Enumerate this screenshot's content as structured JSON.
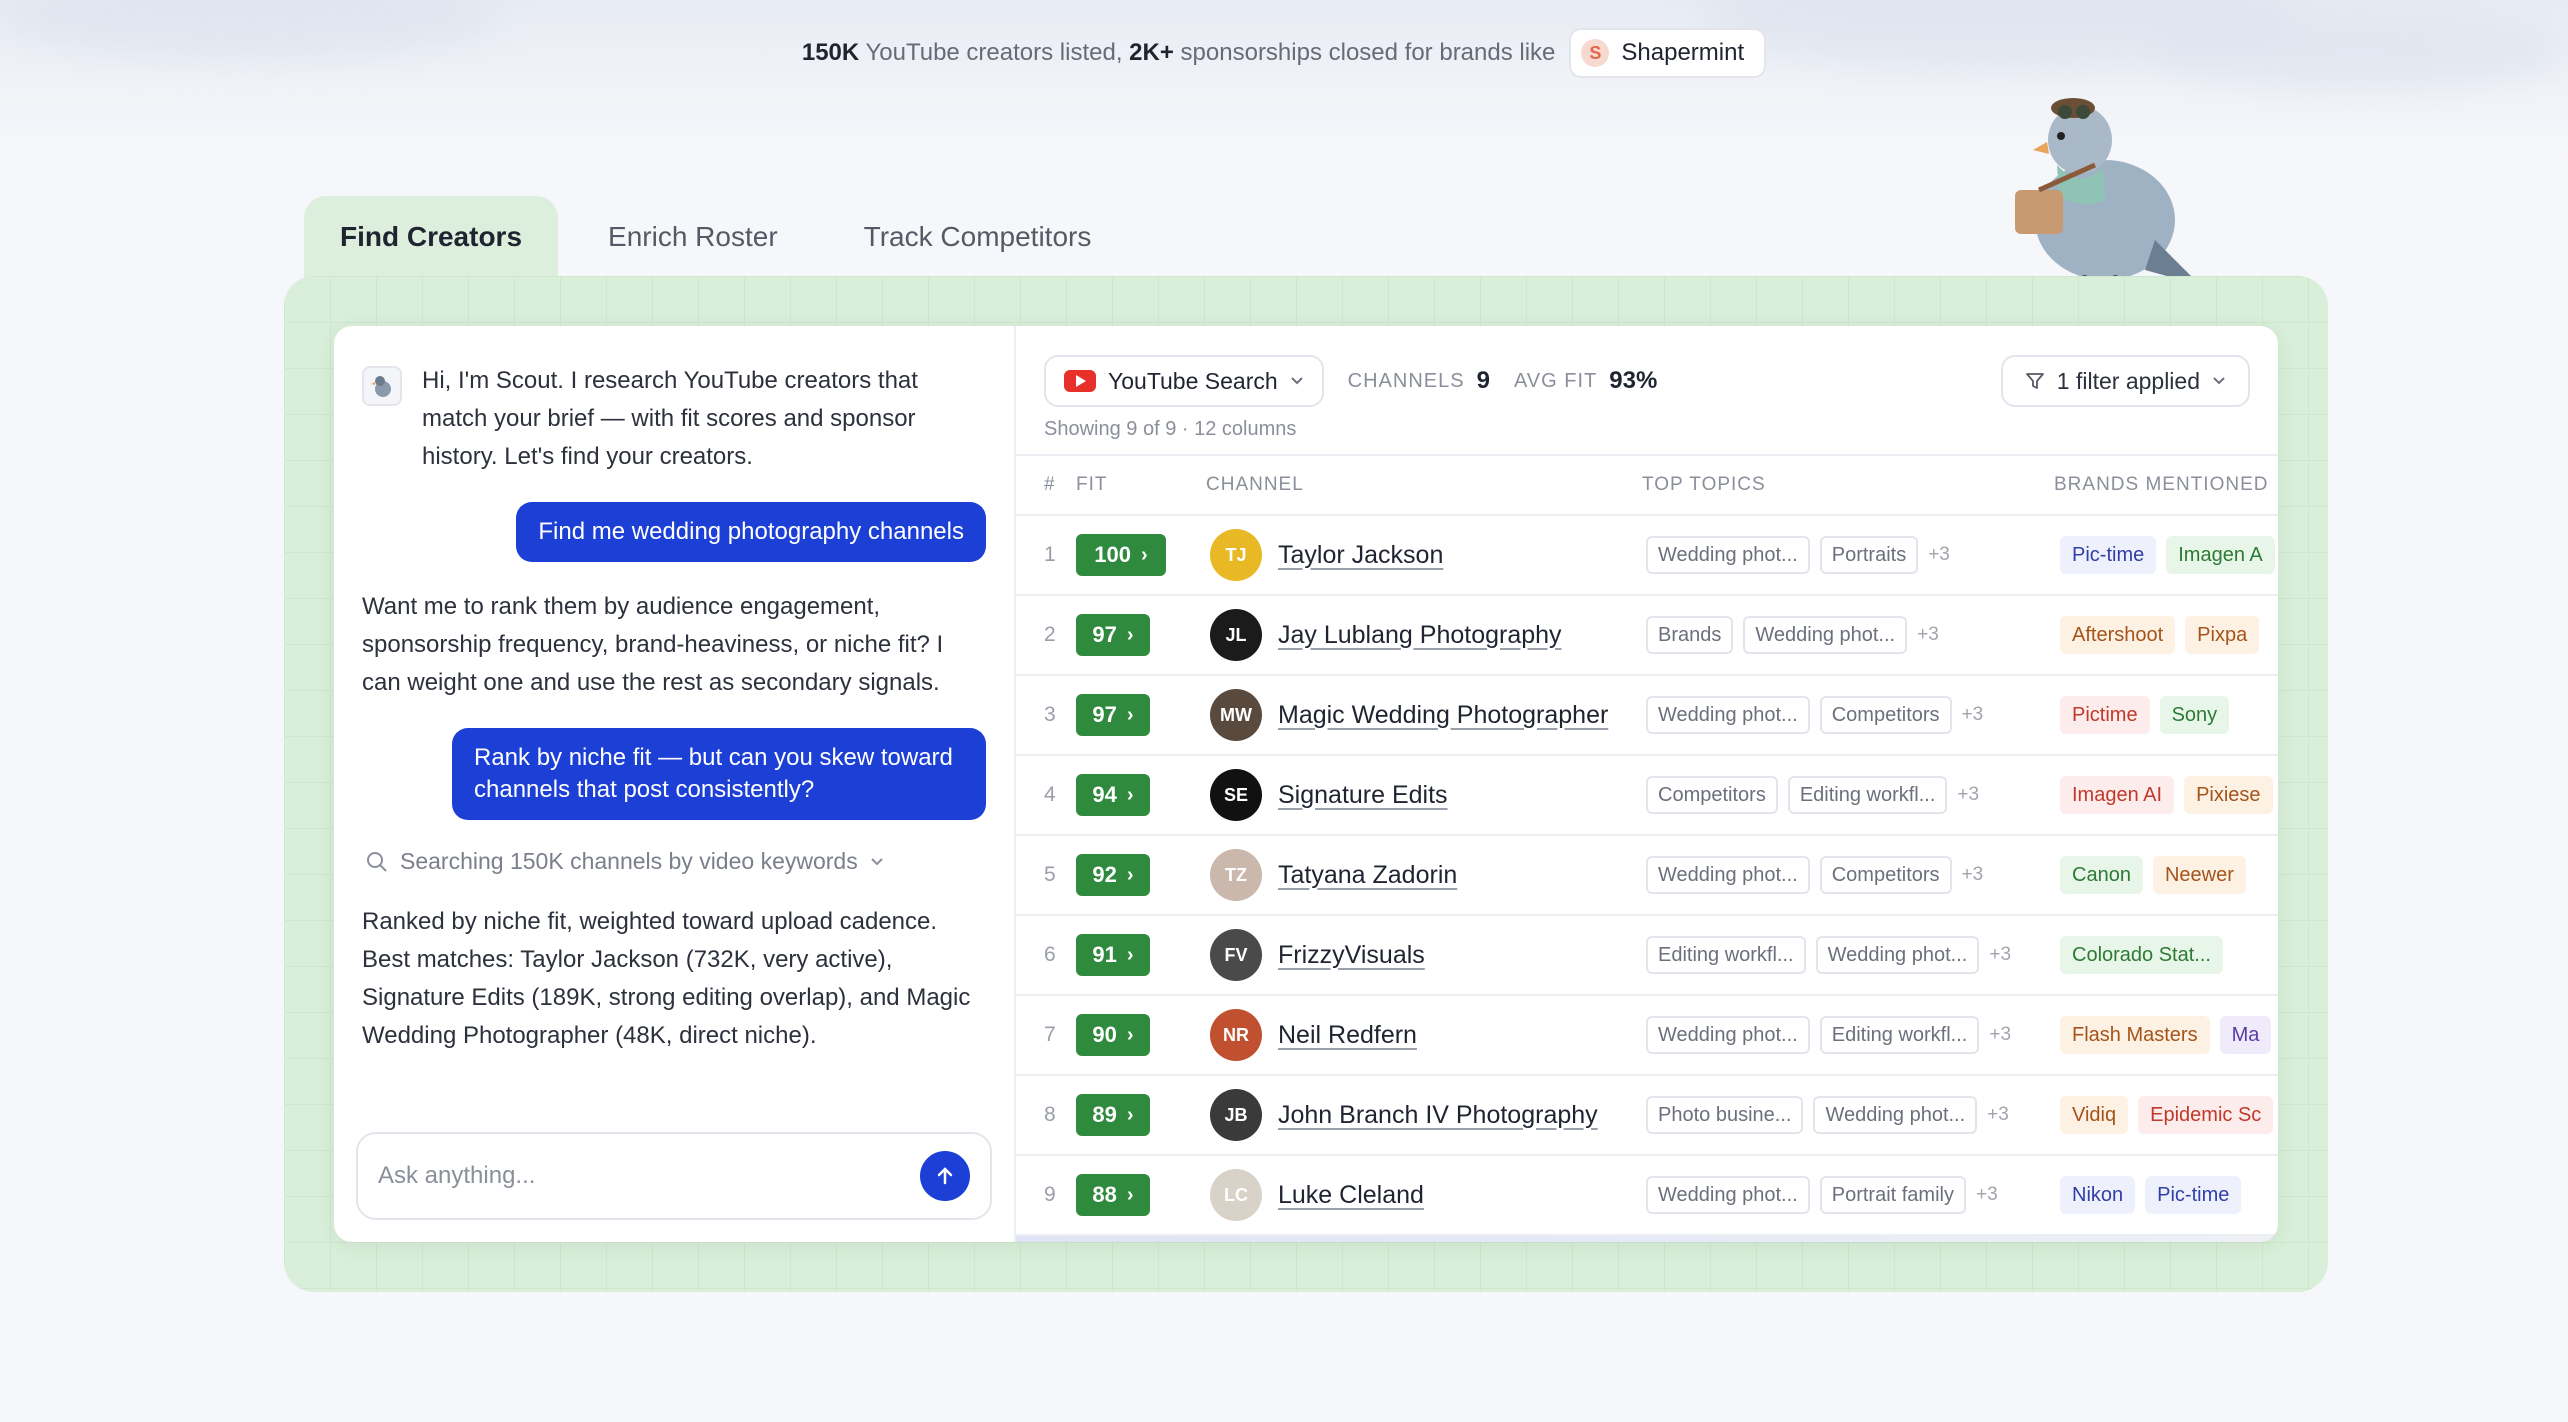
{
  "banner": {
    "count_creators": "150K",
    "text_creators": "YouTube creators listed,",
    "count_sponsorships": "2K+",
    "text_sponsorships": "sponsorships closed for brands like",
    "brand_name": "Shapermint",
    "brand_logo_letter": "S"
  },
  "tabs": [
    {
      "label": "Find Creators",
      "active": true
    },
    {
      "label": "Enrich Roster",
      "active": false
    },
    {
      "label": "Track Competitors",
      "active": false
    }
  ],
  "chat": {
    "greeting": "Hi, I'm Scout. I research YouTube creators that match your brief — with fit scores and sponsor history. Let's find your creators.",
    "user_1": "Find me wedding photography channels",
    "assistant_1": "Want me to rank them by audience engagement, sponsorship frequency, brand-heaviness, or niche fit? I can weight one and use the rest as secondary signals.",
    "user_2": "Rank by niche fit — but can you skew toward channels that post consistently?",
    "searching": "Searching 150K channels by video keywords",
    "assistant_2": "Ranked by niche fit, weighted toward upload cadence. Best matches: Taylor Jackson (732K, very active), Signature Edits (189K, strong editing overlap), and Magic Wedding Photographer (48K, direct niche).",
    "input_placeholder": "Ask anything..."
  },
  "toolbar": {
    "source": "YouTube Search",
    "channels_label": "CHANNELS",
    "channels_value": "9",
    "avgfit_label": "AVG FIT",
    "avgfit_value": "93%",
    "filter": "1 filter applied",
    "showing": "Showing 9 of 9 · 12 columns"
  },
  "table": {
    "headers": [
      "#",
      "FIT",
      "CHANNEL",
      "TOP TOPICS",
      "BRANDS MENTIONED"
    ],
    "rows": [
      {
        "rank": "1",
        "fit": "100",
        "channel": "Taylor Jackson",
        "avatar": "TJ",
        "avatar_color": "#e8b825",
        "topics": [
          "Wedding phot...",
          "Portraits"
        ],
        "more": "+3",
        "brands": [
          {
            "name": "Pic-time",
            "tone": "blue"
          },
          {
            "name": "Imagen A",
            "tone": "green"
          }
        ]
      },
      {
        "rank": "2",
        "fit": "97",
        "channel": "Jay Lublang Photography",
        "avatar": "JL",
        "avatar_color": "#1b1b1b",
        "topics": [
          "Brands",
          "Wedding phot..."
        ],
        "more": "+3",
        "brands": [
          {
            "name": "Aftershoot",
            "tone": "orange"
          },
          {
            "name": "Pixpa",
            "tone": "orange"
          }
        ]
      },
      {
        "rank": "3",
        "fit": "97",
        "channel": "Magic Wedding Photographer",
        "avatar": "MW",
        "avatar_color": "#5a4a3e",
        "topics": [
          "Wedding phot...",
          "Competitors"
        ],
        "more": "+3",
        "brands": [
          {
            "name": "Pictime",
            "tone": "red"
          },
          {
            "name": "Sony",
            "tone": "green"
          }
        ]
      },
      {
        "rank": "4",
        "fit": "94",
        "channel": "Signature Edits",
        "avatar": "SE",
        "avatar_color": "#111111",
        "topics": [
          "Competitors",
          "Editing workfl..."
        ],
        "more": "+3",
        "brands": [
          {
            "name": "Imagen AI",
            "tone": "red"
          },
          {
            "name": "Pixiese",
            "tone": "orange"
          }
        ]
      },
      {
        "rank": "5",
        "fit": "92",
        "channel": "Tatyana Zadorin",
        "avatar": "TZ",
        "avatar_color": "#c9b8ab",
        "topics": [
          "Wedding phot...",
          "Competitors"
        ],
        "more": "+3",
        "brands": [
          {
            "name": "Canon",
            "tone": "green"
          },
          {
            "name": "Neewer",
            "tone": "orange"
          }
        ]
      },
      {
        "rank": "6",
        "fit": "91",
        "channel": "FrizzyVisuals",
        "avatar": "FV",
        "avatar_color": "#4a4a4a",
        "topics": [
          "Editing workfl...",
          "Wedding phot..."
        ],
        "more": "+3",
        "brands": [
          {
            "name": "Colorado Stat...",
            "tone": "green"
          }
        ]
      },
      {
        "rank": "7",
        "fit": "90",
        "channel": "Neil Redfern",
        "avatar": "NR",
        "avatar_color": "#c0502f",
        "topics": [
          "Wedding phot...",
          "Editing workfl..."
        ],
        "more": "+3",
        "brands": [
          {
            "name": "Flash Masters",
            "tone": "orange"
          },
          {
            "name": "Ma",
            "tone": "purple"
          }
        ]
      },
      {
        "rank": "8",
        "fit": "89",
        "channel": "John Branch IV Photography",
        "avatar": "JB",
        "avatar_color": "#3a3a3a",
        "topics": [
          "Photo busine...",
          "Wedding phot..."
        ],
        "more": "+3",
        "brands": [
          {
            "name": "Vidiq",
            "tone": "orange"
          },
          {
            "name": "Epidemic Sc",
            "tone": "red"
          }
        ]
      },
      {
        "rank": "9",
        "fit": "88",
        "channel": "Luke Cleland",
        "avatar": "LC",
        "avatar_color": "#d8d2c8",
        "topics": [
          "Wedding phot...",
          "Portrait family"
        ],
        "more": "+3",
        "brands": [
          {
            "name": "Nikon",
            "tone": "blue"
          },
          {
            "name": "Pic-time",
            "tone": "blue"
          }
        ]
      }
    ]
  },
  "colors": {
    "accent_blue": "#1c3fd6",
    "fit_green": "#2f8a3d",
    "frame_green": "#d9efd9",
    "youtube_red": "#e8302a"
  }
}
